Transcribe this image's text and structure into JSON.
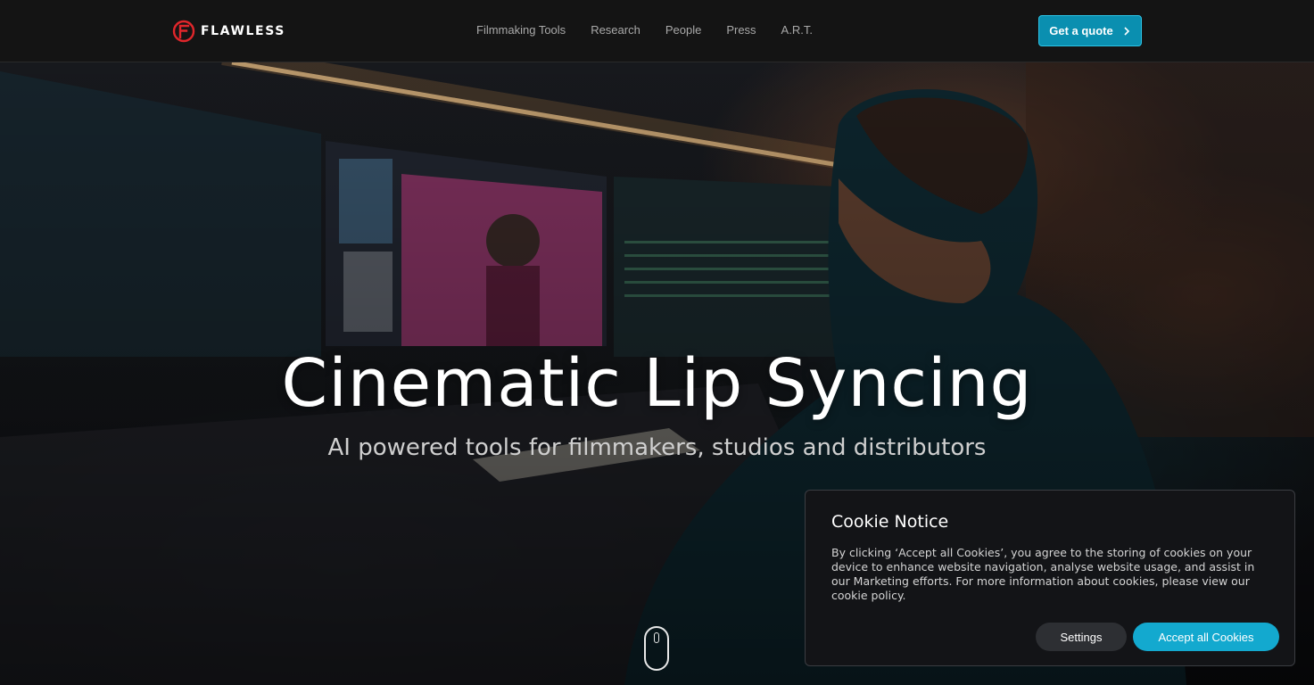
{
  "header": {
    "brand": "FLAWLESS",
    "nav": [
      {
        "label": "Filmmaking Tools"
      },
      {
        "label": "Research"
      },
      {
        "label": "People"
      },
      {
        "label": "Press"
      },
      {
        "label": "A.R.T."
      }
    ],
    "cta_label": "Get a quote"
  },
  "hero": {
    "title": "Cinematic Lip Syncing",
    "subtitle": "AI powered tools for filmmakers, studios and distributors"
  },
  "cookie": {
    "title": "Cookie Notice",
    "text": "By clicking ‘Accept all Cookies’, you agree to the storing of cookies on your device to enhance website navigation, analyse website usage, and assist in our Marketing efforts. For more information about cookies, please view our cookie policy.",
    "settings_label": "Settings",
    "accept_label": "Accept all Cookies"
  },
  "colors": {
    "brand_red": "#e0262b",
    "accent": "#13a9cf",
    "header_bg": "#141414"
  },
  "icons": {
    "logo": "flawless-logo-icon",
    "cta": "chevron-right-icon",
    "scroll": "scroll-mouse-icon"
  }
}
